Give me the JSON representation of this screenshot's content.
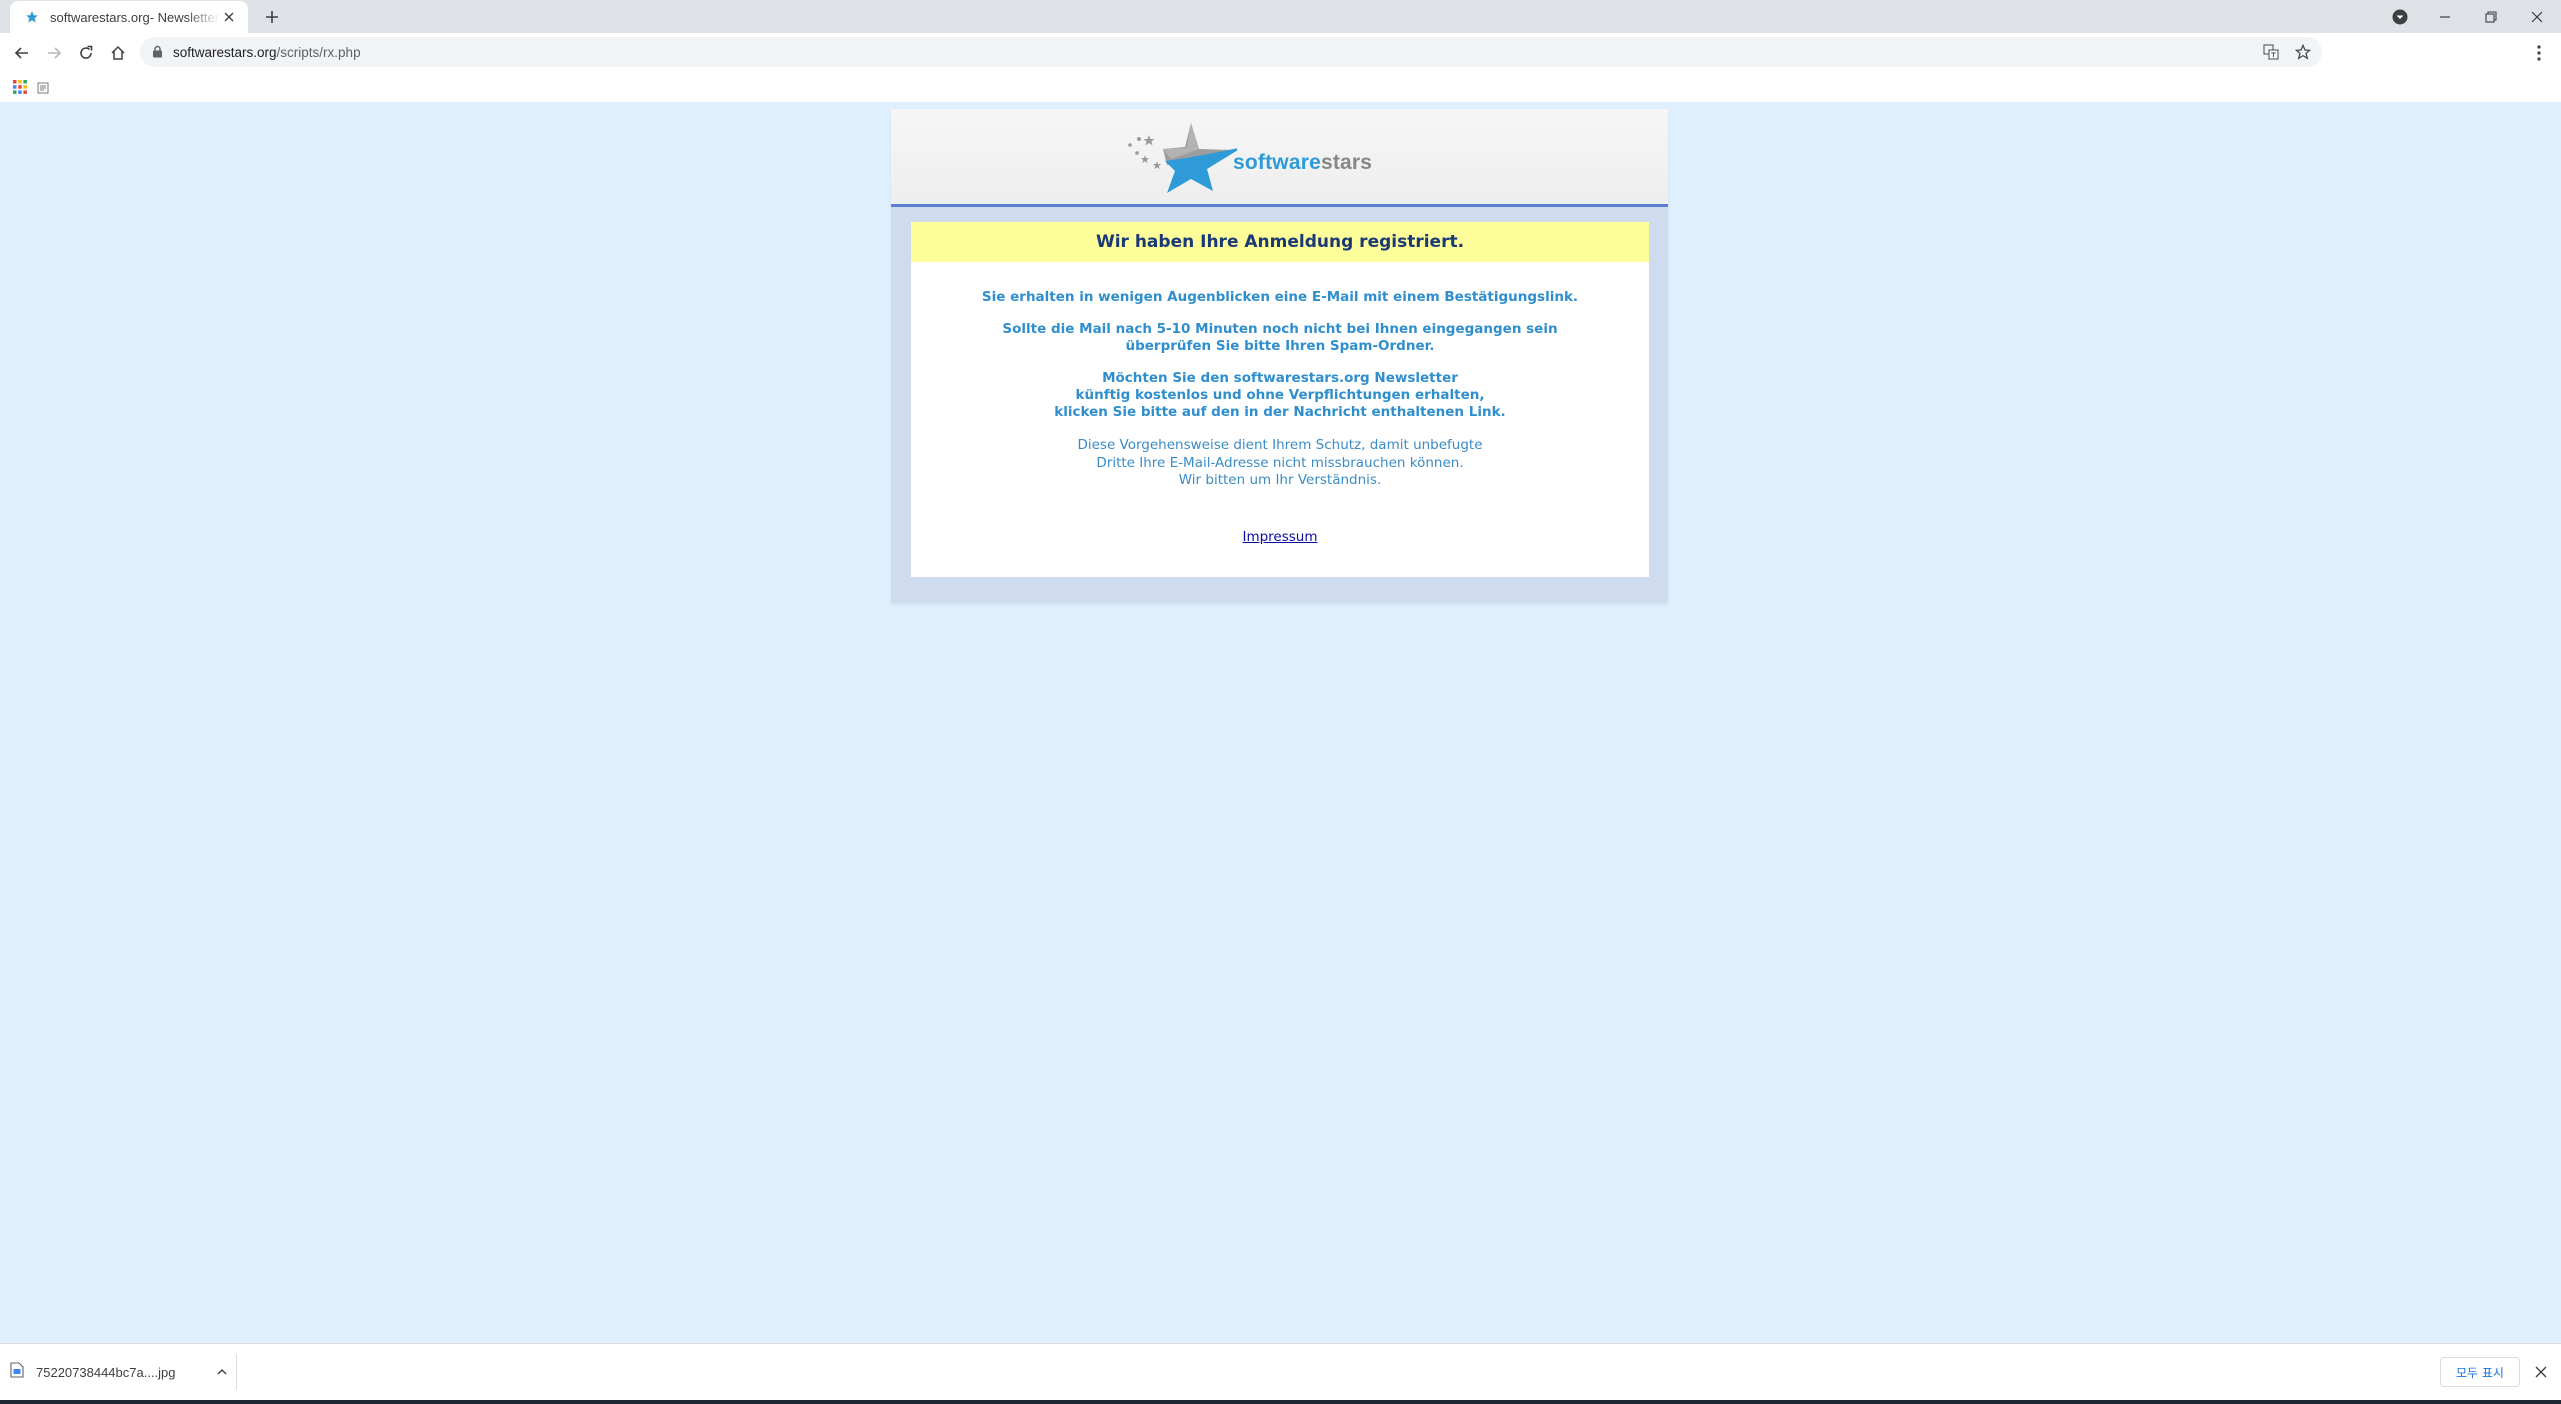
{
  "browser": {
    "tab": {
      "title": "softwarestars.org- Newsletterve"
    },
    "address": {
      "domain": "softwarestars.org",
      "path": "/scripts/rx.php"
    }
  },
  "page": {
    "logo": {
      "part1": "software",
      "part2": "stars"
    },
    "banner": "Wir haben Ihre Anmeldung registriert.",
    "paragraphs": {
      "p1": [
        "Sie erhalten in wenigen Augenblicken eine E-Mail mit einem Bestätigungslink."
      ],
      "p2": [
        "Sollte die Mail nach 5-10 Minuten noch nicht bei Ihnen eingegangen sein",
        "überprüfen Sie bitte Ihren Spam-Ordner."
      ],
      "p3": [
        "Möchten Sie den softwarestars.org Newsletter",
        "künftig kostenlos und ohne Verpflichtungen erhalten,",
        "klicken Sie bitte auf den in der Nachricht enthaltenen Link."
      ],
      "p4": [
        "Diese Vorgehensweise dient Ihrem Schutz, damit unbefugte",
        "Dritte Ihre E-Mail-Adresse nicht missbrauchen können.",
        "Wir bitten um Ihr Verständnis."
      ]
    },
    "impressum": "Impressum"
  },
  "downloads": {
    "item": {
      "name": "75220738444bc7a....jpg"
    },
    "show_all": "모두 표시"
  },
  "colors": {
    "page_bg": "#dfeffd",
    "banner_bg": "#fdfd9a",
    "banner_text": "#1b3a75",
    "body_text": "#2f8fce",
    "header_rule": "#5a7fd0",
    "logo_blue": "#2e9bd8",
    "logo_grey": "#878787"
  }
}
